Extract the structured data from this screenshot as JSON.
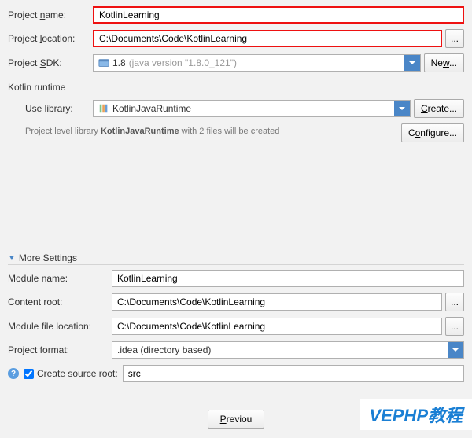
{
  "labels": {
    "projectName": "Project name:",
    "projectLocation": "Project location:",
    "projectSDK": "Project SDK:",
    "kotlinRuntime": "Kotlin runtime",
    "useLibrary": "Use library:",
    "moreSettings": "More Settings",
    "moduleName": "Module name:",
    "contentRoot": "Content root:",
    "moduleFileLocation": "Module file location:",
    "projectFormat": "Project format:",
    "createSourceRoot": "Create source root:"
  },
  "fields": {
    "projectName": "KotlinLearning",
    "projectLocation": "C:\\Documents\\Code\\KotlinLearning",
    "sdkName": "1.8",
    "sdkDetail": "(java version \"1.8.0_121\")",
    "useLibrary": "KotlinJavaRuntime",
    "moduleName": "KotlinLearning",
    "contentRoot": "C:\\Documents\\Code\\KotlinLearning",
    "moduleFileLocation": "C:\\Documents\\Code\\KotlinLearning",
    "projectFormat": ".idea (directory based)",
    "sourceRoot": "src"
  },
  "buttons": {
    "browse": "...",
    "new": "New...",
    "create": "Create...",
    "configure": "Configure...",
    "previous": "Previous"
  },
  "hint": {
    "prefix": "Project level library ",
    "libName": "KotlinJavaRuntime",
    "suffix": " with 2 files will be created"
  },
  "watermark": "VEPHP教程"
}
